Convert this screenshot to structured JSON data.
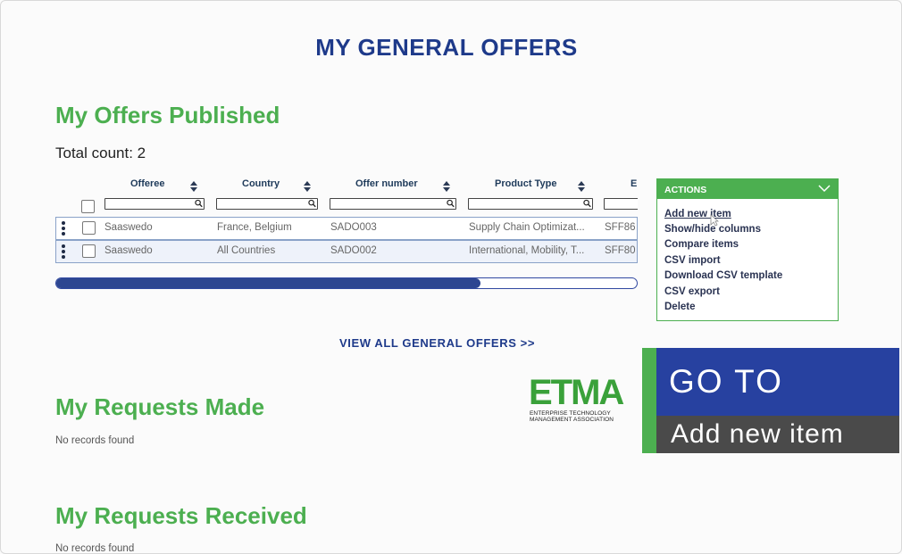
{
  "page": {
    "title": "MY GENERAL OFFERS"
  },
  "offers": {
    "title": "My Offers Published",
    "total_count": "Total count: 2",
    "columns": [
      "Offeree",
      "Country",
      "Offer number",
      "Product Type",
      "E"
    ],
    "rows": [
      {
        "offeree": "Saaswedo",
        "country": "France, Belgium",
        "offer_number": "SADO003",
        "product_type": "Supply Chain Optimizat...",
        "e": "SFF86"
      },
      {
        "offeree": "Saaswedo",
        "country": "All Countries",
        "offer_number": "SADO002",
        "product_type": "International, Mobility, T...",
        "e": "SFF80"
      }
    ],
    "scrollbar_fraction": 0.73
  },
  "actions": {
    "header": "ACTIONS",
    "items": [
      "Add new item",
      "Show/hide columns",
      "Compare items",
      "CSV import",
      "Download CSV template",
      "CSV export",
      "Delete"
    ]
  },
  "view_all": "VIEW ALL GENERAL OFFERS >>",
  "requests_made": {
    "title": "My Requests Made",
    "empty": "No records found"
  },
  "requests_received": {
    "title": "My Requests Received",
    "empty": "No records found"
  },
  "logo": {
    "name": "ETMA",
    "line1": "ENTERPRISE TECHNOLOGY",
    "line2": "MANAGEMENT ASSOCIATION"
  },
  "overlay": {
    "line1": "GO TO",
    "line2": "Add new item"
  },
  "colors": {
    "navy": "#1e3a8a",
    "green": "#4caf50",
    "banner_blue": "#2741a0",
    "banner_gray": "#4a4a4a"
  }
}
